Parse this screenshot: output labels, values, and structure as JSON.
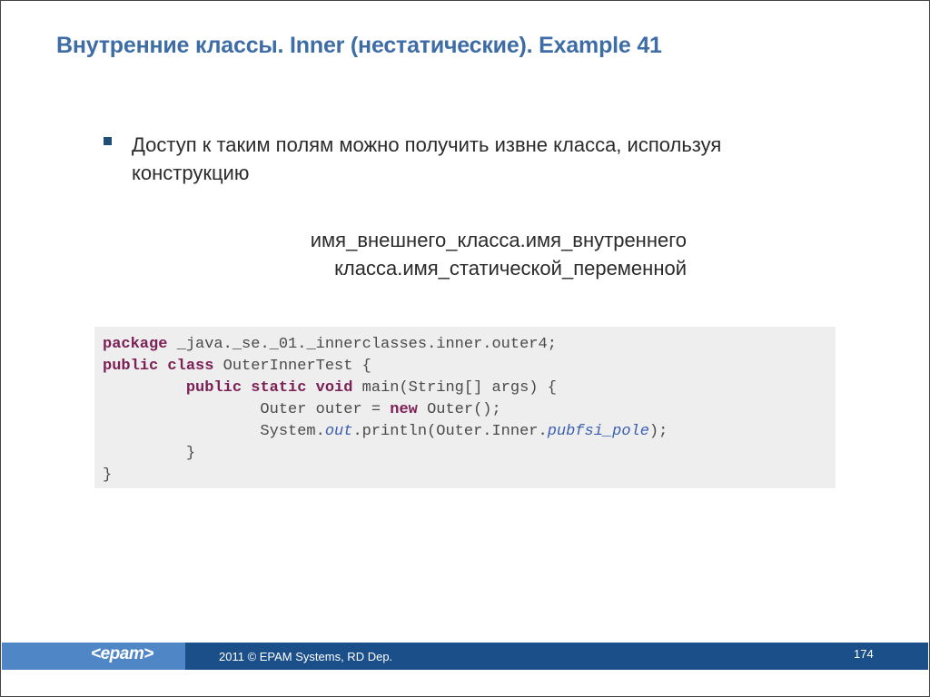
{
  "slide": {
    "title": "Внутренние классы. Inner (нестатические). Example 41",
    "bullet": "Доступ к таким полям можно получить извне класса, используя конструкцию",
    "expression": {
      "line1": "имя_внешнего_класса.имя_внутреннего",
      "line2": "класса.имя_статической_переменной"
    },
    "code": {
      "l1_kw": "package",
      "l1_rest": " _java._se._01._innerclasses.inner.outer4;",
      "l2_kw": "public class",
      "l2_rest": " OuterInnerTest {",
      "l3_indent": "         ",
      "l3_kw": "public static void",
      "l3_rest": " main(String[] args) {",
      "l4_a": "                 Outer outer = ",
      "l4_kw": "new",
      "l4_b": " Outer();",
      "l5_a": "                 System.",
      "l5_it1": "out",
      "l5_b": ".println(Outer.Inner.",
      "l5_it2": "pubfsi_pole",
      "l5_c": ");",
      "l6": "         }",
      "l7": "}"
    }
  },
  "footer": {
    "logo": "<epam>",
    "copyright": "2011 © EPAM Systems, RD Dep.",
    "page_number": "174",
    "colors": {
      "light_bar": "#4f86c6",
      "dark_bar": "#1b4f8a"
    }
  },
  "colors": {
    "title": "#3e6da6",
    "keyword": "#7b1f55",
    "italic_member": "#3a5fb0",
    "bullet_marker": "#1f4e79"
  }
}
